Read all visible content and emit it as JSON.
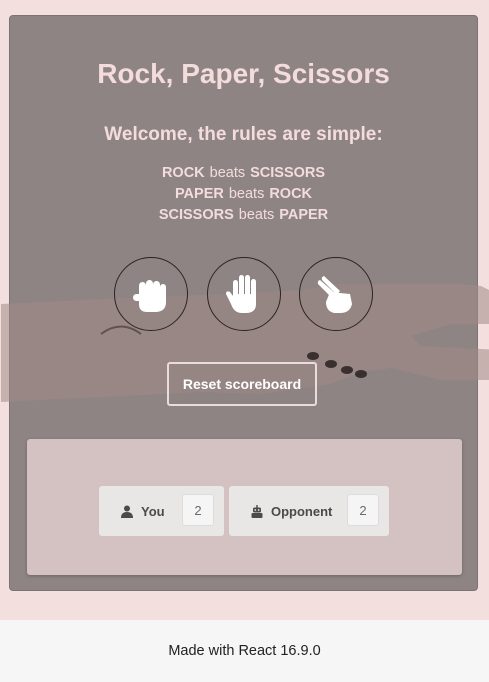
{
  "app": {
    "title": "Rock, Paper, Scissors",
    "subtitle": "Welcome, the rules are simple:"
  },
  "rules": [
    {
      "winner": "ROCK",
      "verb": "beats",
      "loser": "SCISSORS"
    },
    {
      "winner": "PAPER",
      "verb": "beats",
      "loser": "ROCK"
    },
    {
      "winner": "SCISSORS",
      "verb": "beats",
      "loser": "PAPER"
    }
  ],
  "choices": [
    {
      "name": "rock",
      "icon": "fist-icon"
    },
    {
      "name": "paper",
      "icon": "open-hand-icon"
    },
    {
      "name": "scissors",
      "icon": "scissors-hand-icon"
    }
  ],
  "reset_label": "Reset scoreboard",
  "scoreboard": {
    "player": {
      "label": "You",
      "score": "2",
      "icon": "user-icon"
    },
    "opponent": {
      "label": "Opponent",
      "score": "2",
      "icon": "robot-icon"
    }
  },
  "footer": {
    "text": "Made with React 16.9.0"
  },
  "colors": {
    "page_bg": "#f4dfdf",
    "card_bg": "#8e8484",
    "heading": "#f4dcdc",
    "scoreboard_bg": "#d4c1c1"
  }
}
